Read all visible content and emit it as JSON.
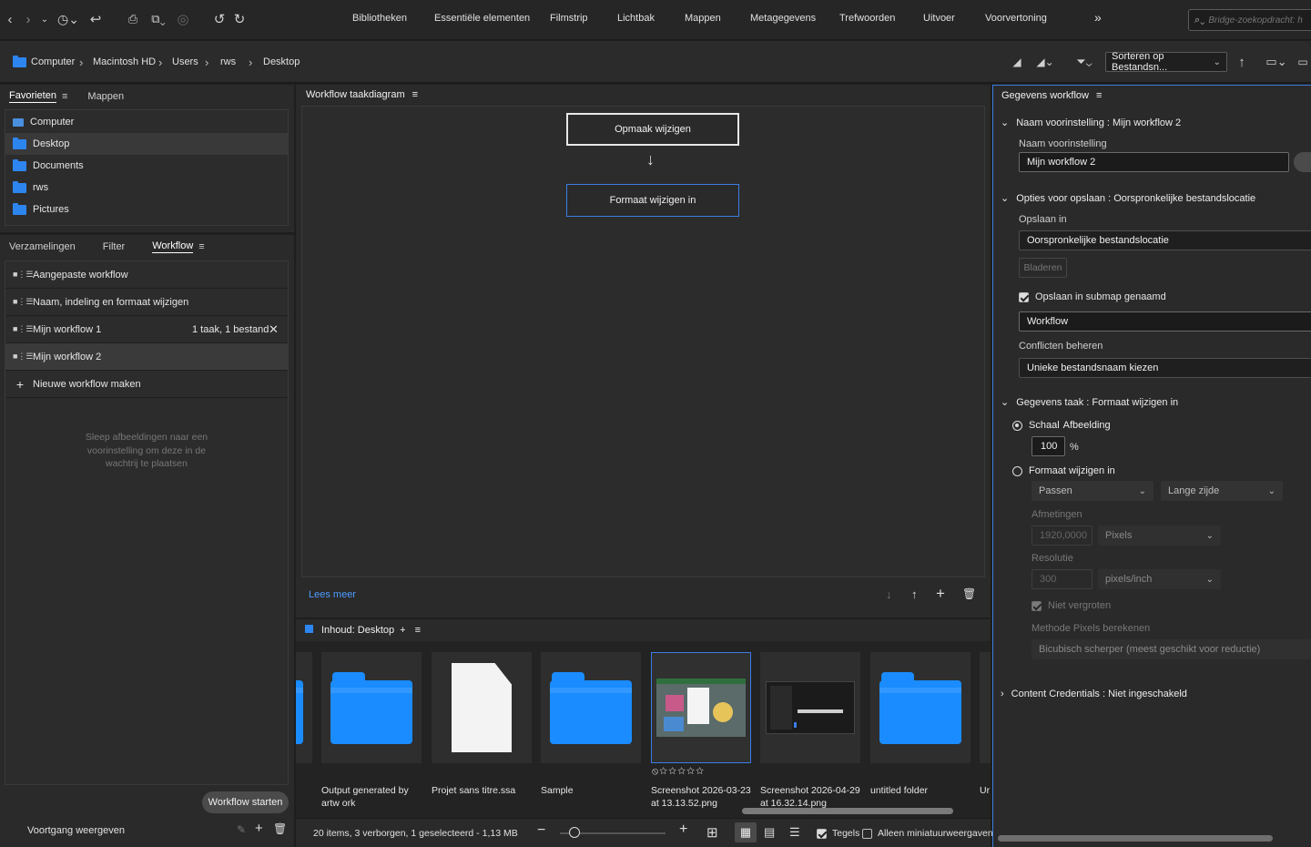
{
  "toolbar": {
    "workspaces": [
      "Bibliotheken",
      "Essentiële elementen",
      "Filmstrip",
      "Lichtbak",
      "Mappen",
      "Metagegevens",
      "Trefwoorden",
      "Uitvoer",
      "Voorvertoning"
    ],
    "more": "»",
    "search_placeholder": "Bridge-zoekopdracht: h"
  },
  "path": {
    "crumbs": [
      "Computer",
      "Macintosh HD",
      "Users",
      "rws",
      "Desktop"
    ],
    "sort_label": "Sorteren op Bestandsn..."
  },
  "left": {
    "tabs_top": [
      "Favorieten",
      "Mappen"
    ],
    "favorites": [
      "Computer",
      "Desktop",
      "Documents",
      "rws",
      "Pictures"
    ],
    "tabs_bottom": [
      "Verzamelingen",
      "Filter",
      "Workflow"
    ],
    "workflows": [
      {
        "name": "Aangepaste workflow",
        "meta": ""
      },
      {
        "name": "Naam, indeling en formaat wijzigen",
        "meta": ""
      },
      {
        "name": "Mijn workflow 1",
        "meta": "1 taak, 1 bestand"
      },
      {
        "name": "Mijn workflow 2",
        "meta": ""
      }
    ],
    "new_workflow": "Nieuwe workflow maken",
    "drop_hint": "Sleep afbeeldingen naar een voorinstelling om deze in de wachtrij te plaatsen",
    "start_button": "Workflow starten",
    "progress_label": "Voortgang weergeven"
  },
  "center": {
    "title": "Workflow taakdiagram",
    "nodes": [
      "Opmaak wijzigen",
      "Formaat wijzigen in"
    ],
    "read_more": "Lees meer"
  },
  "content": {
    "title": "Inhoud: Desktop",
    "items": [
      {
        "label": "Output generated by artw ork",
        "kind": "folder"
      },
      {
        "label": "Projet sans titre.ssa",
        "kind": "doc"
      },
      {
        "label": "Sample",
        "kind": "folder"
      },
      {
        "label": "Screenshot 2026-03-23 at 13.13.52.png",
        "kind": "shot1"
      },
      {
        "label": "Screenshot 2026-04-29 at 16.32.14.png",
        "kind": "shot2"
      },
      {
        "label": "untitled folder",
        "kind": "folder"
      }
    ],
    "partial_label": "Ur",
    "rating": "⦸☆☆☆☆☆",
    "status": "20 items, 3 verborgen, 1 geselecteerd - 1,13 MB",
    "tiles_label": "Tegels",
    "thumbs_only_label": "Alleen miniatuurweergaven"
  },
  "right": {
    "title": "Gegevens workflow",
    "preset_section": "Naam voorinstelling : Mijn workflow 2",
    "preset_label": "Naam voorinstelling",
    "preset_value": "Mijn workflow 2",
    "save_section": "Opties voor opslaan : Oorspronkelijke bestandslocatie",
    "save_in_label": "Opslaan in",
    "save_in_value": "Oorspronkelijke bestandslocatie",
    "browse": "Bladeren",
    "subfolder_label": "Opslaan in submap genaamd",
    "subfolder_value": "Workflow",
    "conflicts_label": "Conflicten beheren",
    "conflicts_value": "Unieke bestandsnaam kiezen",
    "task_section": "Gegevens taak : Formaat wijzigen in",
    "scale_label": "Schaal",
    "scale_suffix": "Afbeelding",
    "scale_value": "100",
    "percent": "%",
    "resize_label": "Formaat wijzigen in",
    "fit_value": "Passen",
    "side_value": "Lange zijde",
    "dimensions_label": "Afmetingen",
    "dimensions_value": "1920,0000",
    "unit_value": "Pixels",
    "resolution_label": "Resolutie",
    "resolution_value": "300",
    "res_unit_value": "pixels/inch",
    "no_enlarge_label": "Niet vergroten",
    "method_label": "Methode Pixels berekenen",
    "method_value": "Bicubisch scherper (meest geschikt voor reductie)",
    "credentials_section": "Content Credentials : Niet ingeschakeld"
  }
}
